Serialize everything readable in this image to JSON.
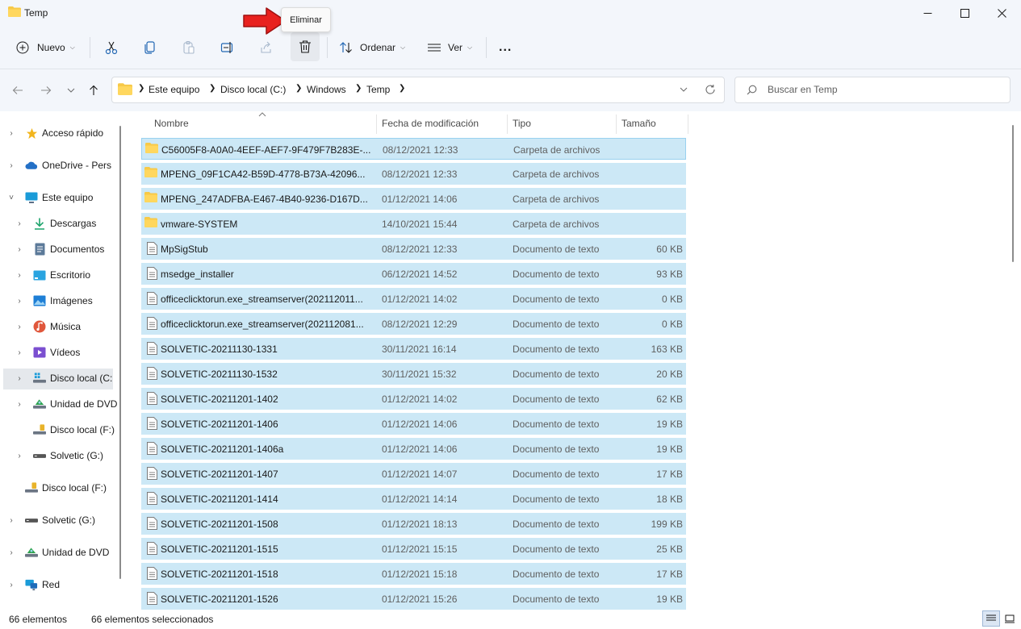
{
  "window": {
    "title": "Temp",
    "controls": [
      "minimize",
      "maximize",
      "close"
    ]
  },
  "toolbar": {
    "new_label": "Nuevo",
    "sort_label": "Ordenar",
    "view_label": "Ver",
    "more_label": "...",
    "tooltip": "Eliminar"
  },
  "address": {
    "crumbs": [
      "Este equipo",
      "Disco local (C:)",
      "Windows",
      "Temp"
    ],
    "search_placeholder": "Buscar en Temp"
  },
  "nav": {
    "items": [
      {
        "label": "Acceso rápido",
        "icon": "star-icon",
        "chevron": "›",
        "color": "#f2b51d"
      },
      {
        "label": "OneDrive - Pers",
        "icon": "cloud-icon",
        "chevron": "›",
        "color": "#2470c6"
      },
      {
        "label": "Este equipo",
        "icon": "monitor-icon",
        "chevron": "˅",
        "color": "#1a9bd8"
      },
      {
        "label": "Descargas",
        "icon": "download-icon",
        "chevron": "›",
        "color": "#1ca36b"
      },
      {
        "label": "Documentos",
        "icon": "document-icon",
        "chevron": "›",
        "color": "#5c7a99"
      },
      {
        "label": "Escritorio",
        "icon": "desktop-icon",
        "chevron": "›",
        "color": "#2aa4e0"
      },
      {
        "label": "Imágenes",
        "icon": "image-icon",
        "chevron": "›",
        "color": "#1e7fd6"
      },
      {
        "label": "Música",
        "icon": "music-icon",
        "chevron": "›",
        "color": "#e0573c"
      },
      {
        "label": "Vídeos",
        "icon": "video-icon",
        "chevron": "›",
        "color": "#7b4fd0"
      },
      {
        "label": "Disco local (C:",
        "icon": "windows-drive-icon",
        "chevron": "›",
        "color": "#1a9bd8"
      },
      {
        "label": "Unidad de DVD",
        "icon": "dvd-icon",
        "chevron": "›",
        "color": "#2da34f"
      },
      {
        "label": "Disco local (F:)",
        "icon": "usb-drive-icon",
        "chevron": "",
        "color": "#e8b32a"
      },
      {
        "label": "Solvetic (G:)",
        "icon": "drive-icon",
        "chevron": "›",
        "color": "#555555"
      },
      {
        "label": "Disco local (F:)",
        "icon": "usb-drive-icon",
        "chevron": "",
        "color": "#e8b32a"
      },
      {
        "label": "Solvetic (G:)",
        "icon": "drive-icon",
        "chevron": "›",
        "color": "#555555"
      },
      {
        "label": "Unidad de DVD",
        "icon": "dvd-icon",
        "chevron": "›",
        "color": "#2da34f"
      },
      {
        "label": "Red",
        "icon": "network-icon",
        "chevron": "›",
        "color": "#1a9bd8"
      }
    ]
  },
  "list": {
    "columns": [
      "Nombre",
      "Fecha de modificación",
      "Tipo",
      "Tamaño"
    ],
    "rows": [
      {
        "name": "C56005F8-A0A0-4EEF-AEF7-9F479F7B283E-...",
        "date": "08/12/2021 12:33",
        "type": "Carpeta de archivos",
        "size": "",
        "kind": "folder"
      },
      {
        "name": "MPENG_09F1CA42-B59D-4778-B73A-42096...",
        "date": "08/12/2021 12:33",
        "type": "Carpeta de archivos",
        "size": "",
        "kind": "folder"
      },
      {
        "name": "MPENG_247ADFBA-E467-4B40-9236-D167D...",
        "date": "01/12/2021 14:06",
        "type": "Carpeta de archivos",
        "size": "",
        "kind": "folder"
      },
      {
        "name": "vmware-SYSTEM",
        "date": "14/10/2021 15:44",
        "type": "Carpeta de archivos",
        "size": "",
        "kind": "folder"
      },
      {
        "name": "MpSigStub",
        "date": "08/12/2021 12:33",
        "type": "Documento de texto",
        "size": "60 KB",
        "kind": "file"
      },
      {
        "name": "msedge_installer",
        "date": "06/12/2021 14:52",
        "type": "Documento de texto",
        "size": "93 KB",
        "kind": "file"
      },
      {
        "name": "officeclicktorun.exe_streamserver(202112011...",
        "date": "01/12/2021 14:02",
        "type": "Documento de texto",
        "size": "0 KB",
        "kind": "file"
      },
      {
        "name": "officeclicktorun.exe_streamserver(202112081...",
        "date": "08/12/2021 12:29",
        "type": "Documento de texto",
        "size": "0 KB",
        "kind": "file"
      },
      {
        "name": "SOLVETIC-20211130-1331",
        "date": "30/11/2021 16:14",
        "type": "Documento de texto",
        "size": "163 KB",
        "kind": "file"
      },
      {
        "name": "SOLVETIC-20211130-1532",
        "date": "30/11/2021 15:32",
        "type": "Documento de texto",
        "size": "20 KB",
        "kind": "file"
      },
      {
        "name": "SOLVETIC-20211201-1402",
        "date": "01/12/2021 14:02",
        "type": "Documento de texto",
        "size": "62 KB",
        "kind": "file"
      },
      {
        "name": "SOLVETIC-20211201-1406",
        "date": "01/12/2021 14:06",
        "type": "Documento de texto",
        "size": "19 KB",
        "kind": "file"
      },
      {
        "name": "SOLVETIC-20211201-1406a",
        "date": "01/12/2021 14:06",
        "type": "Documento de texto",
        "size": "19 KB",
        "kind": "file"
      },
      {
        "name": "SOLVETIC-20211201-1407",
        "date": "01/12/2021 14:07",
        "type": "Documento de texto",
        "size": "17 KB",
        "kind": "file"
      },
      {
        "name": "SOLVETIC-20211201-1414",
        "date": "01/12/2021 14:14",
        "type": "Documento de texto",
        "size": "18 KB",
        "kind": "file"
      },
      {
        "name": "SOLVETIC-20211201-1508",
        "date": "01/12/2021 18:13",
        "type": "Documento de texto",
        "size": "199 KB",
        "kind": "file"
      },
      {
        "name": "SOLVETIC-20211201-1515",
        "date": "01/12/2021 15:15",
        "type": "Documento de texto",
        "size": "25 KB",
        "kind": "file"
      },
      {
        "name": "SOLVETIC-20211201-1518",
        "date": "01/12/2021 15:18",
        "type": "Documento de texto",
        "size": "17 KB",
        "kind": "file"
      },
      {
        "name": "SOLVETIC-20211201-1526",
        "date": "01/12/2021 15:26",
        "type": "Documento de texto",
        "size": "19 KB",
        "kind": "file"
      }
    ]
  },
  "status": {
    "count": "66 elementos",
    "selected": "66 elementos seleccionados"
  },
  "colors": {
    "selection": "#cce8f6",
    "folder": "#f7c948",
    "arrow": "#e8221f"
  }
}
